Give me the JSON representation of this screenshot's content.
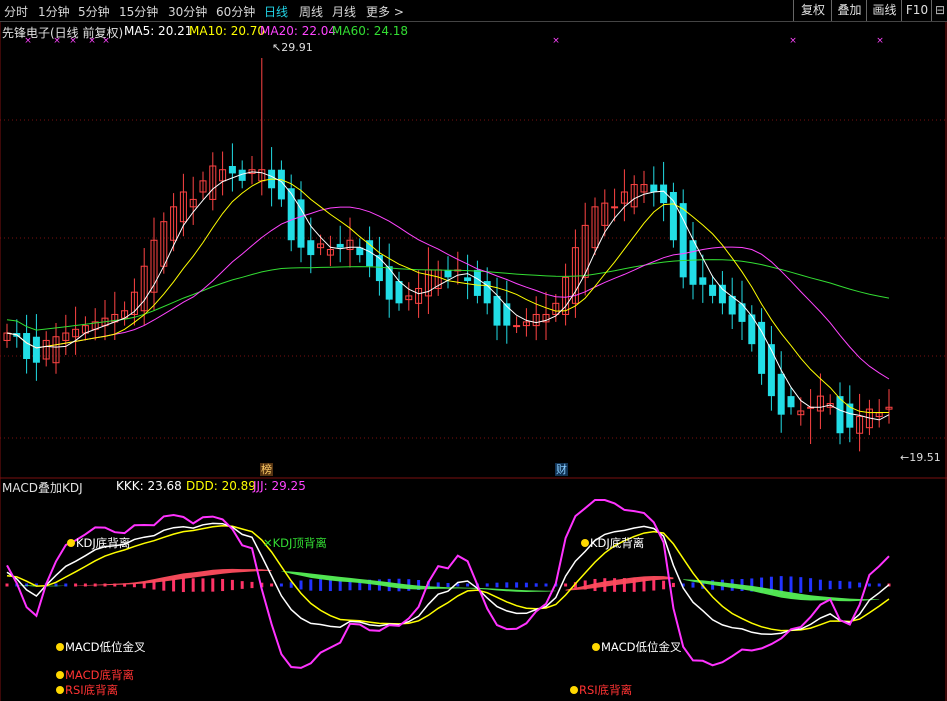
{
  "toolbar": {
    "periods": [
      "分时",
      "1分钟",
      "5分钟",
      "15分钟",
      "30分钟",
      "60分钟",
      "日线",
      "周线",
      "月线",
      "更多 >"
    ],
    "active_period": "日线",
    "right_buttons": [
      "复权",
      "叠加",
      "画线",
      "F10"
    ],
    "tool_glyph": "⊟"
  },
  "main_panel": {
    "title": "先锋电子(日线 前复权)",
    "ma_labels": [
      {
        "text": "MA5: 20.21",
        "color": "#ffffff"
      },
      {
        "text": "MA10: 20.70",
        "color": "#ffff00"
      },
      {
        "text": "MA20: 22.04",
        "color": "#ff44ff"
      },
      {
        "text": "MA60: 24.18",
        "color": "#33dd33"
      }
    ],
    "high_label": "29.91",
    "low_label": "19.51",
    "badges": [
      "榜",
      "财"
    ]
  },
  "sub_panel": {
    "title": "MACD叠加KDJ",
    "kdj_labels": [
      {
        "text": "KKK: 23.68",
        "color": "#ffffff"
      },
      {
        "text": "DDD: 20.89",
        "color": "#ffff00"
      },
      {
        "text": "JJJ: 29.25",
        "color": "#ff44ff"
      }
    ],
    "signals": [
      {
        "text": "KDJ底背离",
        "color": "#ffffff"
      },
      {
        "text": "KDJ顶背离",
        "color": "#33dd33"
      },
      {
        "text": "MACD低位金叉",
        "color": "#ffffff"
      },
      {
        "text": "MACD底背离",
        "color": "#ff3333"
      },
      {
        "text": "RSI底背离",
        "color": "#ff3333"
      },
      {
        "text": "KDJ底背离",
        "color": "#ffffff"
      },
      {
        "text": "MACD低位金叉",
        "color": "#ffffff"
      },
      {
        "text": "RSI底背离",
        "color": "#ff3333"
      }
    ]
  },
  "colors": {
    "up": "#ff4444",
    "down": "#22dde6",
    "ma5": "#ffffff",
    "ma10": "#ffff00",
    "ma20": "#ff44ff",
    "ma60": "#33dd33",
    "grid": "#7a1010",
    "active_tab": "#22d3e6"
  },
  "chart_data": {
    "type": "candlestick",
    "y_axis": {
      "min": 19.51,
      "max": 29.91
    },
    "x": [
      0,
      1,
      2,
      3,
      4,
      5,
      6,
      7,
      8,
      9,
      10,
      11,
      12,
      13,
      14,
      15,
      16,
      17,
      18,
      19,
      20,
      21,
      22,
      23,
      24,
      25,
      26,
      27,
      28,
      29,
      30,
      31,
      32,
      33,
      34,
      35,
      36,
      37,
      38,
      39,
      40,
      41,
      42,
      43,
      44,
      45,
      46,
      47,
      48,
      49,
      50,
      51,
      52,
      53,
      54,
      55,
      56,
      57,
      58,
      59,
      60,
      61,
      62,
      63,
      64,
      65,
      66,
      67,
      68,
      69,
      70,
      71,
      72,
      73,
      74,
      75,
      76,
      77,
      78,
      79,
      80,
      81,
      82,
      83,
      84,
      85,
      86,
      87,
      88,
      89,
      90,
      91,
      92,
      93,
      94
    ],
    "open": [
      22.3,
      22.5,
      22.5,
      22.4,
      21.8,
      21.7,
      22.3,
      22.4,
      22.5,
      22.6,
      22.7,
      22.8,
      22.9,
      23.0,
      23.1,
      23.6,
      24.3,
      25.0,
      25.5,
      25.9,
      26.3,
      26.1,
      26.6,
      27.0,
      26.9,
      26.8,
      26.6,
      26.9,
      26.9,
      26.4,
      26.1,
      25.0,
      24.8,
      24.6,
      24.9,
      24.75,
      24.8,
      25.0,
      24.6,
      24.3,
      23.9,
      23.4,
      23.3,
      23.5,
      23.7,
      24.2,
      24.2,
      24.0,
      24.2,
      23.9,
      23.5,
      23.3,
      22.7,
      22.7,
      22.7,
      22.8,
      23.0,
      23.0,
      23.3,
      24.0,
      24.8,
      25.4,
      25.9,
      26.0,
      25.9,
      26.3,
      26.5,
      26.5,
      26.3,
      26.0,
      25.0,
      24.0,
      23.8,
      23.8,
      23.5,
      23.3,
      23.0,
      22.8,
      22.2,
      21.4,
      20.8,
      20.3,
      20.5,
      20.4,
      20.5,
      20.8,
      20.6,
      19.8,
      19.95,
      20.25,
      20.45
    ],
    "close": [
      22.5,
      22.4,
      21.8,
      21.7,
      22.3,
      22.4,
      22.5,
      22.6,
      22.7,
      22.8,
      22.9,
      23.0,
      23.1,
      23.6,
      24.3,
      25.0,
      25.5,
      25.9,
      26.3,
      26.1,
      26.6,
      27.0,
      26.9,
      26.8,
      26.6,
      26.9,
      26.9,
      26.4,
      26.1,
      25.0,
      24.8,
      24.6,
      24.9,
      24.75,
      24.8,
      25.0,
      24.6,
      24.3,
      23.9,
      23.4,
      23.3,
      23.5,
      23.7,
      24.2,
      24.2,
      24.0,
      24.2,
      23.9,
      23.5,
      23.3,
      22.7,
      22.7,
      22.7,
      22.8,
      23.0,
      23.0,
      23.3,
      24.0,
      24.8,
      25.4,
      25.9,
      26.0,
      25.9,
      26.3,
      26.5,
      26.5,
      26.3,
      26.0,
      25.0,
      24.0,
      23.8,
      23.8,
      23.5,
      23.3,
      23.0,
      22.8,
      22.2,
      21.4,
      20.8,
      20.3,
      20.5,
      20.4,
      20.5,
      20.8,
      20.6,
      19.8,
      19.95,
      20.25,
      20.45,
      20.35,
      20.5
    ]
  }
}
